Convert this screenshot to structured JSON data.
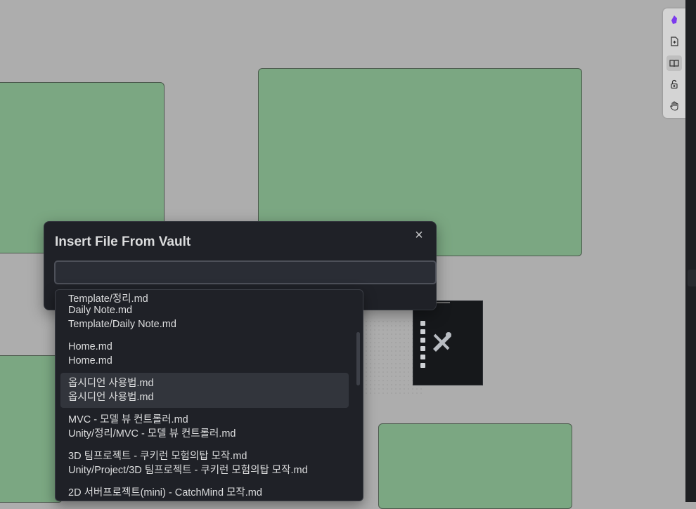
{
  "modal": {
    "title": "Insert File From Vault",
    "close_label": "×",
    "search": {
      "value": "",
      "placeholder": ""
    }
  },
  "suggestions": [
    {
      "name": "",
      "path": "Template/정리.md"
    },
    {
      "name": "Daily Note.md",
      "path": "Template/Daily Note.md"
    },
    {
      "name": "Home.md",
      "path": "Home.md"
    },
    {
      "name": "옵시디언 사용법.md",
      "path": "옵시디언 사용법.md",
      "selected": true
    },
    {
      "name": "MVC - 모델 뷰 컨트롤러.md",
      "path": "Unity/정리/MVC - 모델 뷰 컨트롤러.md"
    },
    {
      "name": "3D 팀프로젝트 - 쿠키런 모험의탑 모작.md",
      "path": "Unity/Project/3D 팀프로젝트 - 쿠키런 모험의탑 모작.md"
    },
    {
      "name": "2D 서버프로젝트(mini) - CatchMind 모작.md",
      "path": ""
    }
  ],
  "toolbar": {
    "icons": [
      "obsidian-logo-icon",
      "file-plus-icon",
      "book-open-icon",
      "unlock-icon",
      "hand-icon"
    ],
    "active": "book-open-icon"
  },
  "colors": {
    "card_fill": "#7ba782",
    "modal_bg": "#1f2127",
    "accent": "#7c3aed"
  }
}
